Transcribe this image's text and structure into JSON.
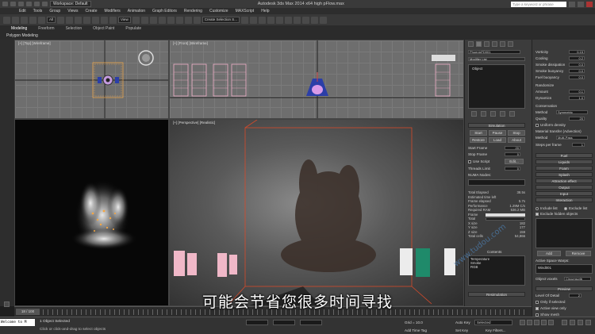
{
  "titlebar": {
    "workspace": "Workspace: Default",
    "title": "Autodesk 3ds Max 2014 x64   high pFlow.max",
    "search_placeholder": "Type a keyword or phrase"
  },
  "menu": [
    "Edit",
    "Tools",
    "Group",
    "Views",
    "Create",
    "Modifiers",
    "Animation",
    "Graph Editors",
    "Rendering",
    "Customize",
    "MAXScript",
    "Help"
  ],
  "toolbar": {
    "selection_filter": "All",
    "ref_coord": "View",
    "named_selection": "Create Selection S..."
  },
  "ribbon": {
    "tabs": [
      "Modeling",
      "Freeform",
      "Selection",
      "Object Paint",
      "Populate"
    ],
    "sub": "Polygon Modeling"
  },
  "viewports": {
    "top": "[+] [Top] [Wireframe]",
    "front": "[+] [Front] [Wireframe]",
    "perspective": "[+] [Perspective] [Realistic]"
  },
  "panel": {
    "object_name": "PhoenixFD001",
    "modifier_list": "Modifier List",
    "stack_item": "Object",
    "simulation": {
      "title": "Simulation",
      "start": "Start",
      "pause": "Pause",
      "stop": "Stop",
      "restore": "Restore",
      "load": "Load",
      "about": "About",
      "start_frame_label": "Start Frame",
      "start_frame": "20",
      "stop_frame_label": "Stop Frame",
      "stop_frame": "0",
      "use_script": "Use Script",
      "edit": "Edit...",
      "threads_label": "Threads Limit",
      "threads": "0",
      "numa": "NUMA Nodes:",
      "stats": [
        [
          "Total Elapsed",
          "38.5s"
        ],
        [
          "Estimated time left",
          ""
        ],
        [
          "Frame elapsed",
          "5.7s"
        ],
        [
          "Performance",
          "1.29M C/s"
        ],
        [
          "Required RAM",
          "536.2 MB"
        ],
        [
          "Frame",
          ""
        ],
        [
          "Total",
          ""
        ],
        [
          "X size",
          "182"
        ],
        [
          "Y size",
          "177"
        ],
        [
          "Z size",
          "159"
        ],
        [
          "Total cells",
          "54,866"
        ]
      ],
      "contents_label": "Contents",
      "contents": [
        "Temperature",
        "Smoke",
        "RGB"
      ],
      "resimulation": "Resimulation"
    }
  },
  "panel2": {
    "fields": [
      [
        "Vorticity",
        "0.15"
      ],
      [
        "Cooling",
        "0.2"
      ],
      [
        "Smoke dissipation",
        "0.0"
      ],
      [
        "Smoke buoyancy",
        "0.0"
      ],
      [
        "Fuel buoyancy",
        "0.0"
      ],
      [
        "Randomize",
        ""
      ],
      [
        "Amount",
        "0.1"
      ],
      [
        "Dynamics",
        "1.0"
      ]
    ],
    "conservation": "Conservation",
    "method_label": "Method",
    "method": "Symmetric",
    "quality_label": "Quality",
    "quality": "20",
    "uniform_density": "Uniform density",
    "mat_transfer": "Material transfer (Advection)",
    "method2": "Multi-Pass",
    "steps_label": "Steps per frame",
    "steps": "1",
    "rollouts": [
      "Fuel",
      "Liquids",
      "Foam",
      "Splash",
      "Attraction effect",
      "Output",
      "Input",
      "Interaction"
    ],
    "include_list": "Include list",
    "exclude_list": "Exclude list",
    "exclude_hidden": "Exclude hidden objects",
    "add": "Add",
    "remove": "Remove",
    "active_space_label": "Active Space Warps:",
    "wind": "Wind001",
    "object_voxels_label": "Object voxels",
    "object_voxels": "Circumscrib",
    "preview": "Preview",
    "lod_label": "Level Of Detail",
    "lod": "2",
    "only_if_selected": "Only if selected",
    "active_view_only": "Active view only",
    "show_mesh": "Show mesh"
  },
  "timeline": {
    "slider": "18 / 100"
  },
  "status": {
    "maxscript": "Welcome to M",
    "selected": "1 Object Selected",
    "prompt": "Click or click-and-drag to select objects",
    "grid": "Grid = 10.0",
    "autokey": "Auto Key",
    "autokey_value": "Selected",
    "setkey": "Set Key",
    "keyfilters": "Key Filters...",
    "addtimetag": "Add Time Tag"
  },
  "subtitle": "可能会节省您很多时间寻找",
  "watermark": "www.tudou.com"
}
